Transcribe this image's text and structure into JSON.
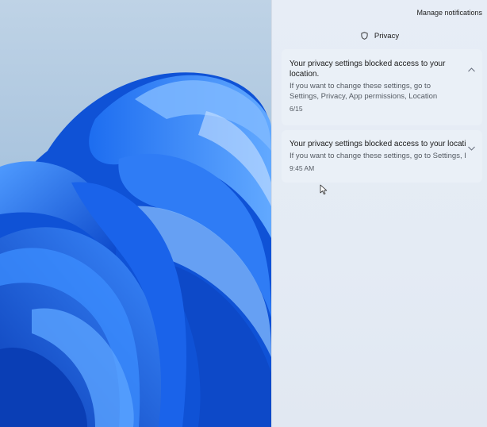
{
  "notification_center": {
    "manage_label": "Manage notifications",
    "group": {
      "icon": "shield-icon",
      "app_name": "Privacy"
    },
    "notifications": [
      {
        "title": "Your privacy settings blocked access to your location.",
        "body": "If you want to change these settings, go to Settings, Privacy, App permissions, Location",
        "time": "6/15",
        "expanded": true,
        "chevron": "chevron-up-icon"
      },
      {
        "title": "Your privacy settings blocked access to your location.",
        "body": "If you want to change these settings, go to Settings, Privacy, App permissions, Location",
        "time": "9:45 AM",
        "expanded": false,
        "chevron": "chevron-down-icon"
      }
    ]
  },
  "colors": {
    "wallpaper_bloom": "#1565e8",
    "pane_background": "#e5ecf5",
    "card_background": "#eaf0f7"
  }
}
